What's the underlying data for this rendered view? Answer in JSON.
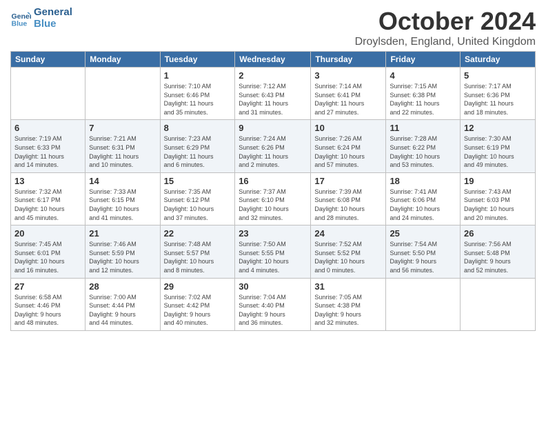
{
  "logo": {
    "line1": "General",
    "line2": "Blue"
  },
  "title": "October 2024",
  "location": "Droylsden, England, United Kingdom",
  "weekdays": [
    "Sunday",
    "Monday",
    "Tuesday",
    "Wednesday",
    "Thursday",
    "Friday",
    "Saturday"
  ],
  "weeks": [
    [
      {
        "day": "",
        "info": ""
      },
      {
        "day": "",
        "info": ""
      },
      {
        "day": "1",
        "info": "Sunrise: 7:10 AM\nSunset: 6:46 PM\nDaylight: 11 hours\nand 35 minutes."
      },
      {
        "day": "2",
        "info": "Sunrise: 7:12 AM\nSunset: 6:43 PM\nDaylight: 11 hours\nand 31 minutes."
      },
      {
        "day": "3",
        "info": "Sunrise: 7:14 AM\nSunset: 6:41 PM\nDaylight: 11 hours\nand 27 minutes."
      },
      {
        "day": "4",
        "info": "Sunrise: 7:15 AM\nSunset: 6:38 PM\nDaylight: 11 hours\nand 22 minutes."
      },
      {
        "day": "5",
        "info": "Sunrise: 7:17 AM\nSunset: 6:36 PM\nDaylight: 11 hours\nand 18 minutes."
      }
    ],
    [
      {
        "day": "6",
        "info": "Sunrise: 7:19 AM\nSunset: 6:33 PM\nDaylight: 11 hours\nand 14 minutes."
      },
      {
        "day": "7",
        "info": "Sunrise: 7:21 AM\nSunset: 6:31 PM\nDaylight: 11 hours\nand 10 minutes."
      },
      {
        "day": "8",
        "info": "Sunrise: 7:23 AM\nSunset: 6:29 PM\nDaylight: 11 hours\nand 6 minutes."
      },
      {
        "day": "9",
        "info": "Sunrise: 7:24 AM\nSunset: 6:26 PM\nDaylight: 11 hours\nand 2 minutes."
      },
      {
        "day": "10",
        "info": "Sunrise: 7:26 AM\nSunset: 6:24 PM\nDaylight: 10 hours\nand 57 minutes."
      },
      {
        "day": "11",
        "info": "Sunrise: 7:28 AM\nSunset: 6:22 PM\nDaylight: 10 hours\nand 53 minutes."
      },
      {
        "day": "12",
        "info": "Sunrise: 7:30 AM\nSunset: 6:19 PM\nDaylight: 10 hours\nand 49 minutes."
      }
    ],
    [
      {
        "day": "13",
        "info": "Sunrise: 7:32 AM\nSunset: 6:17 PM\nDaylight: 10 hours\nand 45 minutes."
      },
      {
        "day": "14",
        "info": "Sunrise: 7:33 AM\nSunset: 6:15 PM\nDaylight: 10 hours\nand 41 minutes."
      },
      {
        "day": "15",
        "info": "Sunrise: 7:35 AM\nSunset: 6:12 PM\nDaylight: 10 hours\nand 37 minutes."
      },
      {
        "day": "16",
        "info": "Sunrise: 7:37 AM\nSunset: 6:10 PM\nDaylight: 10 hours\nand 32 minutes."
      },
      {
        "day": "17",
        "info": "Sunrise: 7:39 AM\nSunset: 6:08 PM\nDaylight: 10 hours\nand 28 minutes."
      },
      {
        "day": "18",
        "info": "Sunrise: 7:41 AM\nSunset: 6:06 PM\nDaylight: 10 hours\nand 24 minutes."
      },
      {
        "day": "19",
        "info": "Sunrise: 7:43 AM\nSunset: 6:03 PM\nDaylight: 10 hours\nand 20 minutes."
      }
    ],
    [
      {
        "day": "20",
        "info": "Sunrise: 7:45 AM\nSunset: 6:01 PM\nDaylight: 10 hours\nand 16 minutes."
      },
      {
        "day": "21",
        "info": "Sunrise: 7:46 AM\nSunset: 5:59 PM\nDaylight: 10 hours\nand 12 minutes."
      },
      {
        "day": "22",
        "info": "Sunrise: 7:48 AM\nSunset: 5:57 PM\nDaylight: 10 hours\nand 8 minutes."
      },
      {
        "day": "23",
        "info": "Sunrise: 7:50 AM\nSunset: 5:55 PM\nDaylight: 10 hours\nand 4 minutes."
      },
      {
        "day": "24",
        "info": "Sunrise: 7:52 AM\nSunset: 5:52 PM\nDaylight: 10 hours\nand 0 minutes."
      },
      {
        "day": "25",
        "info": "Sunrise: 7:54 AM\nSunset: 5:50 PM\nDaylight: 9 hours\nand 56 minutes."
      },
      {
        "day": "26",
        "info": "Sunrise: 7:56 AM\nSunset: 5:48 PM\nDaylight: 9 hours\nand 52 minutes."
      }
    ],
    [
      {
        "day": "27",
        "info": "Sunrise: 6:58 AM\nSunset: 4:46 PM\nDaylight: 9 hours\nand 48 minutes."
      },
      {
        "day": "28",
        "info": "Sunrise: 7:00 AM\nSunset: 4:44 PM\nDaylight: 9 hours\nand 44 minutes."
      },
      {
        "day": "29",
        "info": "Sunrise: 7:02 AM\nSunset: 4:42 PM\nDaylight: 9 hours\nand 40 minutes."
      },
      {
        "day": "30",
        "info": "Sunrise: 7:04 AM\nSunset: 4:40 PM\nDaylight: 9 hours\nand 36 minutes."
      },
      {
        "day": "31",
        "info": "Sunrise: 7:05 AM\nSunset: 4:38 PM\nDaylight: 9 hours\nand 32 minutes."
      },
      {
        "day": "",
        "info": ""
      },
      {
        "day": "",
        "info": ""
      }
    ]
  ]
}
